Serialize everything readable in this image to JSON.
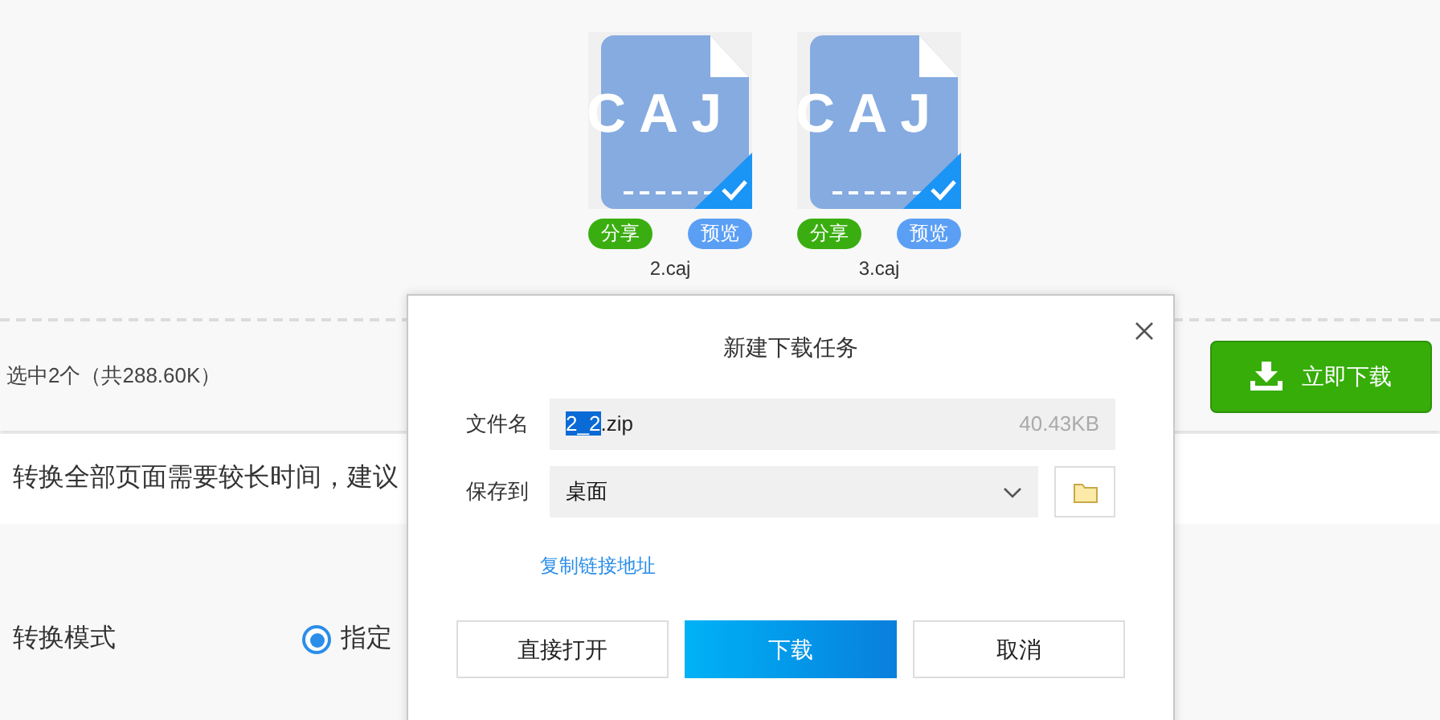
{
  "files": [
    {
      "icon_text": "CAJ",
      "name": "2.caj",
      "selected": true,
      "share": "分享",
      "preview": "预览"
    },
    {
      "icon_text": "CAJ",
      "name": "3.caj",
      "selected": true,
      "share": "分享",
      "preview": "预览"
    }
  ],
  "selection_bar": {
    "summary": "选中2个（共288.60K）",
    "download_button": "立即下载"
  },
  "notice": "转换全部页面需要较长时间，建议",
  "mode": {
    "label": "转换模式",
    "options": [
      {
        "label": "指定",
        "selected": true
      }
    ]
  },
  "dialog": {
    "title": "新建下载任务",
    "file_label": "文件名",
    "file_name": {
      "selected": "2_2",
      "rest": ".zip"
    },
    "file_size": "40.43KB",
    "save_label": "保存到",
    "save_location": "桌面",
    "copy_link": "复制链接地址",
    "buttons": [
      {
        "label": "直接打开",
        "kind": "outline"
      },
      {
        "label": "下载",
        "kind": "primary"
      },
      {
        "label": "取消",
        "kind": "outline"
      }
    ]
  }
}
